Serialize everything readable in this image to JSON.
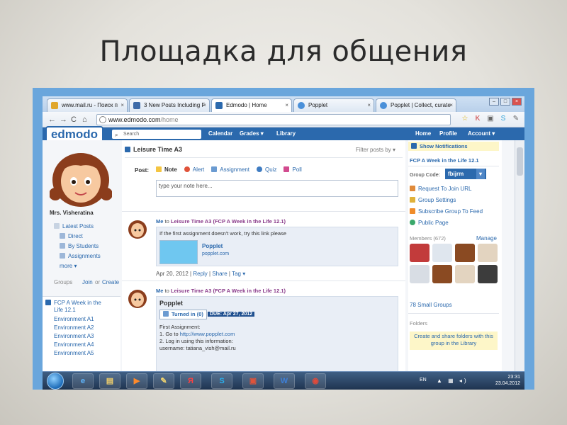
{
  "slide": {
    "title": "Площадка для общения"
  },
  "browser": {
    "tabs": [
      {
        "label": "www.mail.ru - Поиск п",
        "color": "#e0a62b"
      },
      {
        "label": "3 New Posts Including F",
        "color": "#3c6aa8"
      },
      {
        "label": "Edmodo | Home",
        "color": "#2b69ad"
      },
      {
        "label": "Popplet",
        "color": "#4a90d9"
      },
      {
        "label": "Popplet | Collect, curate",
        "color": "#4a90d9"
      }
    ],
    "url_host": "www.edmodo.com",
    "url_path": "/home"
  },
  "edmodo": {
    "logo": "edmodo",
    "search_placeholder": "Search",
    "nav": {
      "calendar": "Calendar",
      "grades": "Grades ▾",
      "library": "Library",
      "home": "Home",
      "profile": "Profile",
      "account": "Account ▾"
    },
    "left": {
      "user_name": "Mrs. Visheratina",
      "latest_posts": "Latest Posts",
      "direct": "Direct",
      "by_students": "By Students",
      "assignments": "Assignments",
      "more": "more",
      "groups_label": "Groups",
      "join": "Join",
      "or": "or",
      "create": "Create",
      "groups": [
        "FCP A Week in the Life 12.1",
        "Environment A1",
        "Environment A2",
        "Environment A3",
        "Environment A4",
        "Environment A5"
      ]
    },
    "center": {
      "group_title": "Leisure Time A3",
      "filter": "Filter posts by ▾",
      "post_label": "Post:",
      "post_types": [
        "Note",
        "Alert",
        "Assignment",
        "Quiz",
        "Poll"
      ],
      "note_placeholder": "type your note here...",
      "post1": {
        "me": "Me",
        "to": "to",
        "target": "Leisure Time A3 (FCP A Week in the Life 12.1)",
        "text": "If the first assignment doesn't work, try this link please",
        "link_title": "Popplet",
        "link_url": "popplet.com",
        "date": "Apr 20, 2012",
        "reply": "Reply",
        "share": "Share",
        "tag": "Tag ▾"
      },
      "post2": {
        "me": "Me",
        "to": "to",
        "target": "Leisure Time A3 (FCP A Week in the Life 12.1)",
        "title": "Popplet",
        "turned_in": "Turned in (0)",
        "due": "DUE: Apr 27, 2012",
        "line1": "First Assignment:",
        "line2_prefix": "1. Go to",
        "line2_link": "http://www.popplet.com",
        "line3": "2. Log in using this information:",
        "line4": "username: tatiana_vish@mail.ru"
      }
    },
    "right": {
      "show_notifications": "Show Notifications",
      "group_title": "FCP A Week in the Life 12.1",
      "group_code_label": "Group Code:",
      "group_code": "fbijrm",
      "request_join": "Request To Join URL",
      "group_settings": "Group Settings",
      "subscribe": "Subscribe Group To Feed",
      "public_page": "Public Page",
      "members_label": "Members",
      "members_count": "(672)",
      "manage": "Manage",
      "small_groups": "78 Small Groups",
      "folders_label": "Folders",
      "folders_text": "Create and share folders with this group in the Library"
    }
  },
  "taskbar": {
    "lang": "EN",
    "time": "23:31",
    "date": "23.04.2012",
    "apps": [
      "e",
      "▤",
      "▶",
      "✎",
      "Я",
      "S",
      "▣",
      "W",
      "◉"
    ]
  },
  "colors": {
    "frame": "#6aa6dc",
    "edmodo_blue": "#2b69ad",
    "due_bg": "#1f4f8f"
  }
}
